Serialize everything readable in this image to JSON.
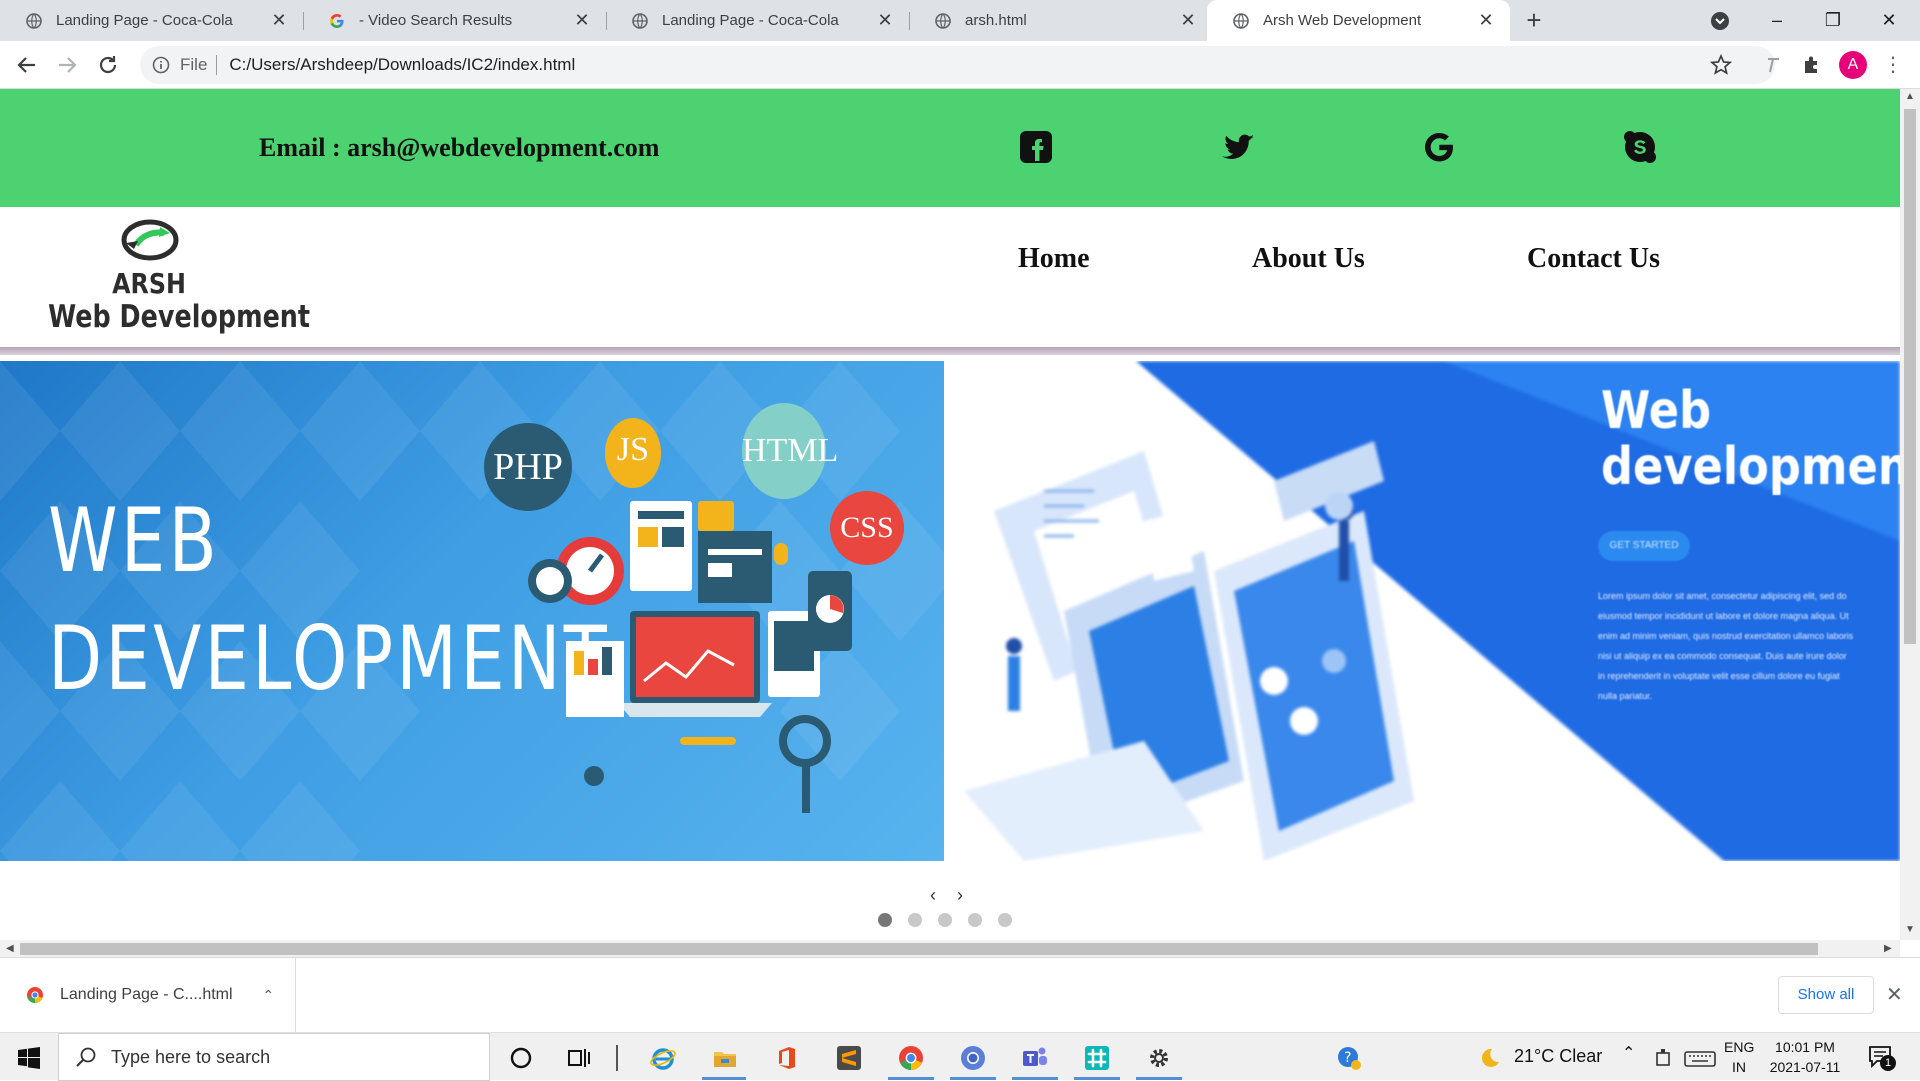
{
  "browser": {
    "tabs": [
      {
        "title": "Landing Page - Coca-Cola",
        "favicon": "globe-icon",
        "active": false
      },
      {
        "title": "- Video Search Results",
        "favicon": "google-icon",
        "active": false
      },
      {
        "title": "Landing Page - Coca-Cola",
        "favicon": "globe-icon",
        "active": false
      },
      {
        "title": "arsh.html",
        "favicon": "globe-icon",
        "active": false
      },
      {
        "title": "Arsh Web Development",
        "favicon": "globe-icon",
        "active": true
      }
    ],
    "new_tab": "+",
    "omnibox": {
      "scheme": "File",
      "url": "C:/Users/Arshdeep/Downloads/IC2/index.html"
    },
    "profile_initial": "A"
  },
  "page": {
    "email": "Email : arsh@webdevelopment.com",
    "social_icons": [
      "facebook-icon",
      "twitter-icon",
      "google-icon",
      "skype-icon"
    ],
    "logo": {
      "line1": "ARSH",
      "line2": "Web Development"
    },
    "nav": [
      "Home",
      "About Us",
      "Contact Us"
    ],
    "slider": {
      "left_title": [
        "WEB",
        "DEVELOPMENT"
      ],
      "bubbles": [
        "PHP",
        "JS",
        "HTML",
        "CSS"
      ],
      "right_title": [
        "Web",
        "development"
      ],
      "right_button": "GET STARTED",
      "right_text": "Lorem ipsum dolor sit amet, consectetur adipiscing elit, sed do eiusmod tempor incididunt ut labore et dolore magna aliqua. Ut enim ad minim veniam, quis nostrud exercitation ullamco laboris nisi ut aliquip ex ea commodo consequat. Duis aute irure dolor in reprehenderit in voluptate velit esse cillum dolore eu fugiat nulla pariatur.",
      "arrows": "‹ ›",
      "dot_count": 5,
      "active_dot": 0
    },
    "colors": {
      "topbar": "#4cd271",
      "slide_left": "#3f9ee4",
      "slide_right": "#1f63e0"
    }
  },
  "downloads": {
    "item": "Landing Page - C....html",
    "show_all": "Show all"
  },
  "taskbar": {
    "search_placeholder": "Type here to search",
    "weather": "21°C  Clear",
    "lang": "ENG",
    "region": "IN",
    "time": "10:01 PM",
    "date": "2021-07-11",
    "notification_count": "1"
  }
}
